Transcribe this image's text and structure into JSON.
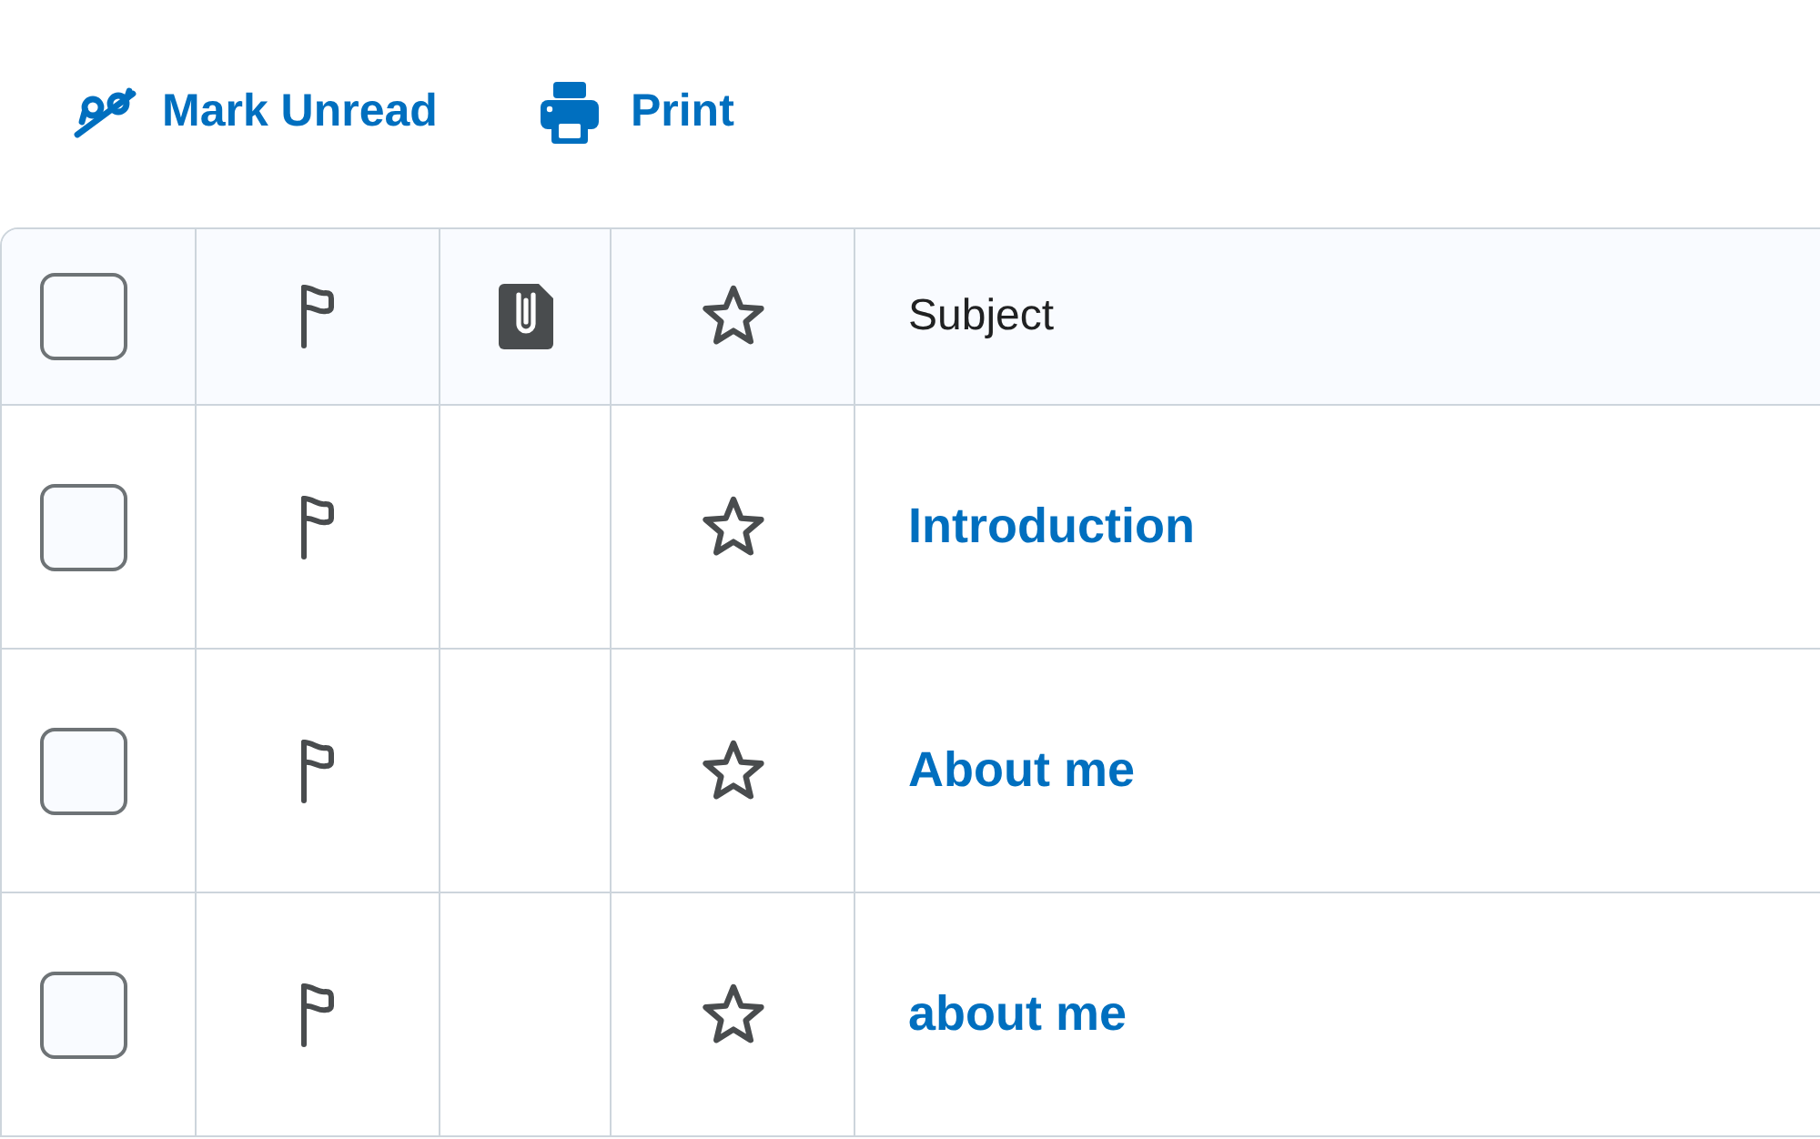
{
  "toolbar": [
    {
      "kind": "mark_unread",
      "label": "Mark Unread"
    },
    {
      "kind": "print",
      "label": "Print"
    }
  ],
  "table": {
    "header": {
      "checked": false,
      "subject_label": "Subject"
    },
    "rows": [
      {
        "checked": false,
        "flagged": false,
        "starred": false,
        "subject": "Introduction"
      },
      {
        "checked": false,
        "flagged": false,
        "starred": false,
        "subject": "About me"
      },
      {
        "checked": false,
        "flagged": false,
        "starred": false,
        "subject": "about me"
      }
    ]
  }
}
